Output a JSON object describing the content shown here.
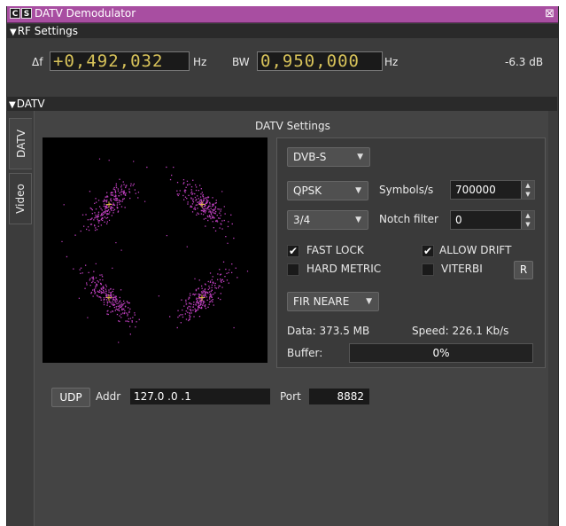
{
  "window": {
    "title": "DATV Demodulator",
    "btn_c": "C",
    "btn_s": "S",
    "close_glyph": "⊠"
  },
  "rf": {
    "section_label": "RF Settings",
    "delta_label": "Δf",
    "delta_value": "+0,492,032",
    "delta_unit": "Hz",
    "bw_label": "BW",
    "bw_value": "0,950,000",
    "bw_unit": "Hz",
    "power": "-6.3 dB"
  },
  "datv": {
    "section_label": "DATV",
    "tabs": [
      "DATV",
      "Video"
    ],
    "settings_title": "DATV Settings",
    "standard": "DVB-S",
    "modulation": "QPSK",
    "symbols_label": "Symbols/s",
    "symbols_value": "700000",
    "fec": "3/4",
    "notch_label": "Notch filter",
    "notch_value": "0",
    "fast_lock_label": "FAST LOCK",
    "fast_lock_checked": true,
    "allow_drift_label": "ALLOW DRIFT",
    "allow_drift_checked": true,
    "hard_metric_label": "HARD METRIC",
    "hard_metric_checked": false,
    "viterbi_label": "VITERBI",
    "viterbi_checked": false,
    "reset_label": "R",
    "filter": "FIR NEARE",
    "data_text": "Data: 373.5 MB",
    "speed_text": "Speed: 226.1 Kb/s",
    "buffer_label": "Buffer:",
    "buffer_percent": "0%",
    "buffer_fraction": 0,
    "udp_label": "UDP",
    "addr_label": "Addr",
    "addr_value": "127.0 .0 .1",
    "port_label": "Port",
    "port_value": "8882",
    "check_glyph": "✔"
  },
  "colors": {
    "title_bar": "#a84ea1",
    "constellation_points": "#c040c0",
    "constellation_markers": "#e0c040"
  }
}
